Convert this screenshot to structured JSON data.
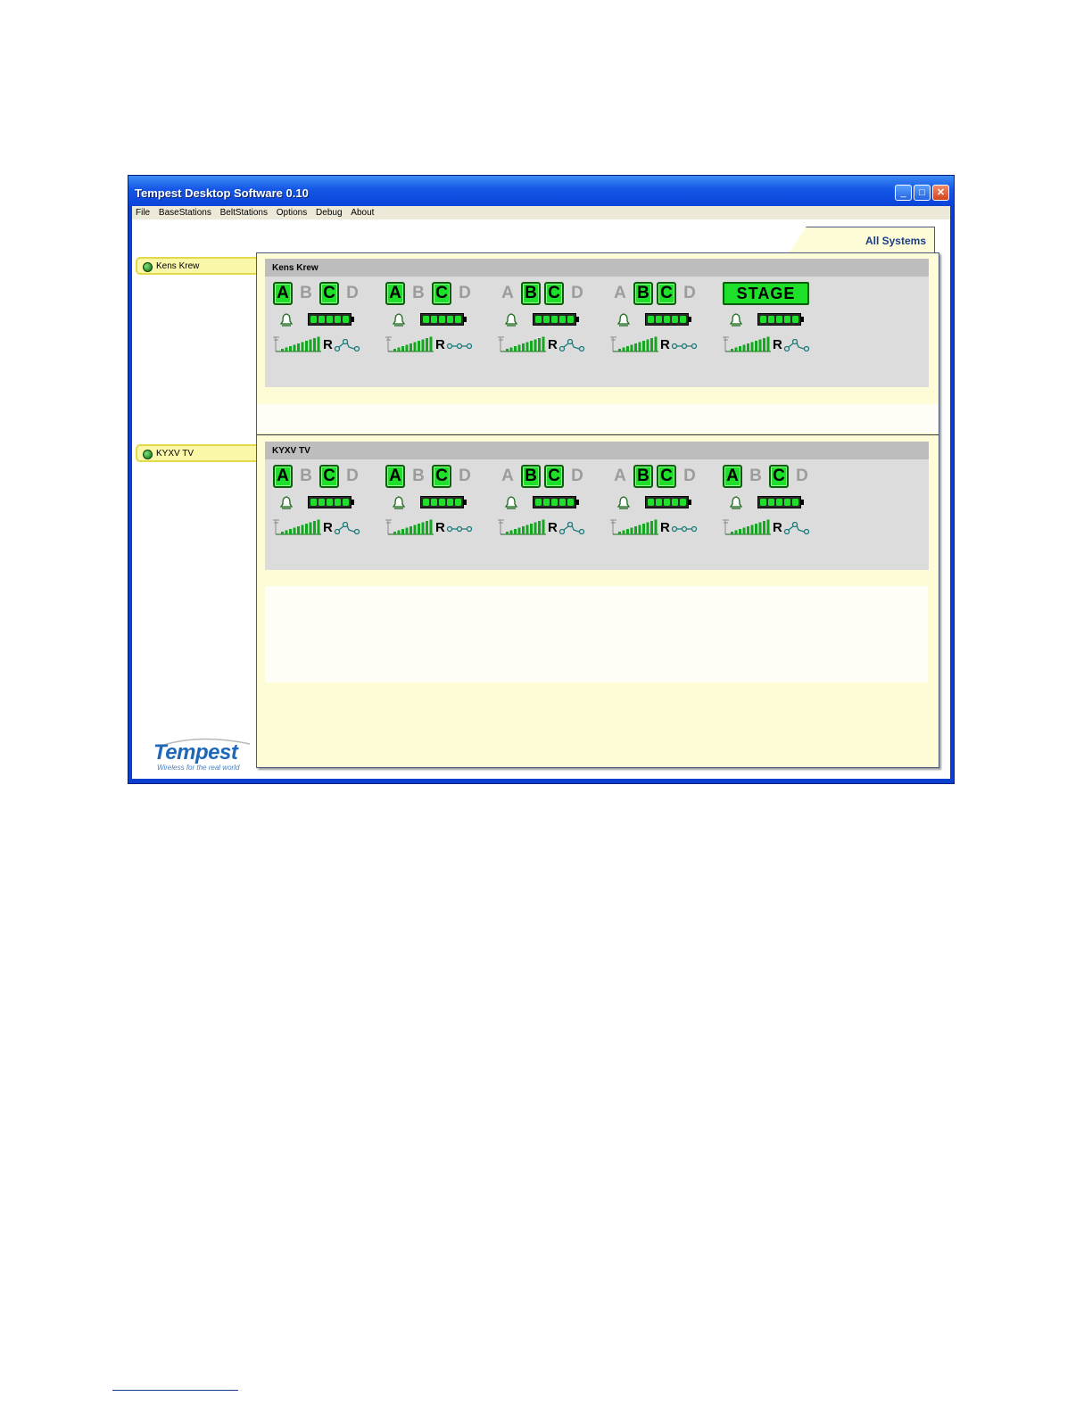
{
  "window": {
    "title": "Tempest Desktop Software 0.10",
    "buttons": {
      "minimize": "_",
      "maximize": "□",
      "close": "✕"
    }
  },
  "menu": [
    "File",
    "BaseStations",
    "BeltStations",
    "Options",
    "Debug",
    "About"
  ],
  "tab": {
    "label": "All Systems"
  },
  "sidebar": [
    {
      "label": "Kens Krew"
    },
    {
      "label": "KYXV TV"
    }
  ],
  "systems": [
    {
      "name": "Kens Krew",
      "units": [
        {
          "letters": [
            "A",
            "B",
            "C",
            "D"
          ],
          "active": [
            true,
            false,
            true,
            false
          ],
          "r_label": "R",
          "battery": 5,
          "signal_bars": 10,
          "link": "active"
        },
        {
          "letters": [
            "A",
            "B",
            "C",
            "D"
          ],
          "active": [
            true,
            false,
            true,
            false
          ],
          "r_label": "R",
          "battery": 5,
          "signal_bars": 10,
          "link": "idle"
        },
        {
          "letters": [
            "A",
            "B",
            "C",
            "D"
          ],
          "active": [
            false,
            true,
            true,
            false
          ],
          "r_label": "R",
          "battery": 5,
          "signal_bars": 10,
          "link": "active"
        },
        {
          "letters": [
            "A",
            "B",
            "C",
            "D"
          ],
          "active": [
            false,
            true,
            true,
            false
          ],
          "r_label": "R",
          "battery": 5,
          "signal_bars": 10,
          "link": "idle"
        },
        {
          "stage_label": "STAGE",
          "r_label": "R",
          "battery": 5,
          "signal_bars": 10,
          "link": "active"
        }
      ]
    },
    {
      "name": "KYXV TV",
      "units": [
        {
          "letters": [
            "A",
            "B",
            "C",
            "D"
          ],
          "active": [
            true,
            false,
            true,
            false
          ],
          "r_label": "R",
          "battery": 5,
          "signal_bars": 10,
          "link": "active"
        },
        {
          "letters": [
            "A",
            "B",
            "C",
            "D"
          ],
          "active": [
            true,
            false,
            true,
            false
          ],
          "r_label": "R",
          "battery": 5,
          "signal_bars": 10,
          "link": "idle"
        },
        {
          "letters": [
            "A",
            "B",
            "C",
            "D"
          ],
          "active": [
            false,
            true,
            true,
            false
          ],
          "r_label": "R",
          "battery": 5,
          "signal_bars": 10,
          "link": "active"
        },
        {
          "letters": [
            "A",
            "B",
            "C",
            "D"
          ],
          "active": [
            false,
            true,
            true,
            false
          ],
          "r_label": "R",
          "battery": 5,
          "signal_bars": 10,
          "link": "idle"
        },
        {
          "letters": [
            "A",
            "B",
            "C",
            "D"
          ],
          "active": [
            true,
            false,
            true,
            false
          ],
          "r_label": "R",
          "battery": 5,
          "signal_bars": 10,
          "link": "active"
        }
      ]
    }
  ],
  "logo": {
    "name": "Tempest",
    "tagline": "Wireless for the real world"
  },
  "icons": {
    "bell": "bell-icon",
    "battery": "battery-icon",
    "signal": "signal-strength-icon",
    "link": "link-icon",
    "led": "status-led-icon"
  },
  "colors": {
    "active_green": "#1ee02a",
    "inactive_letter": "#9c9c9c",
    "panel_bg": "#fdfcd6",
    "titlebar": "#0a43d8",
    "tab_text": "#1a3d8a"
  }
}
